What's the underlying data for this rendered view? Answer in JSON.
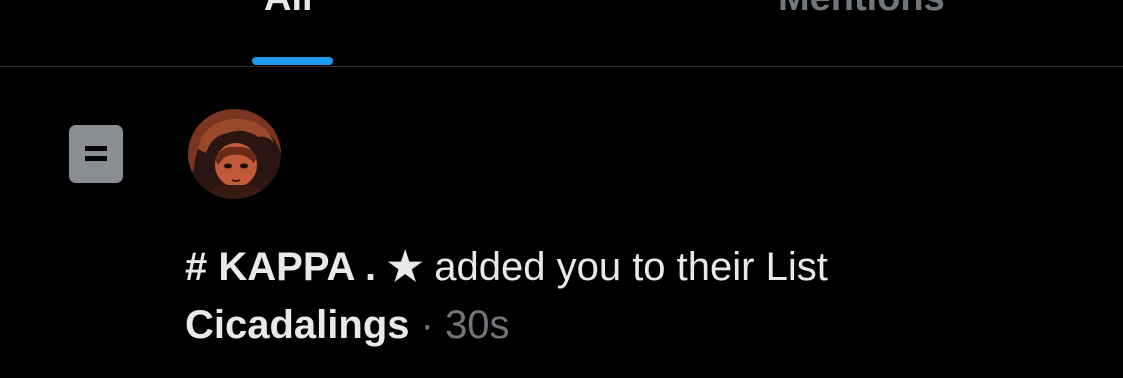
{
  "tabs": [
    {
      "label": "All",
      "selected": true
    },
    {
      "label": "Mentions",
      "selected": false
    }
  ],
  "notification": {
    "icon": "list-icon",
    "avatar": "user-avatar",
    "user_name": "# KAPPA . ★",
    "action_text": " added you to their List",
    "list_name": "Cicadalings",
    "separator": " · ",
    "timestamp": "30s"
  },
  "colors": {
    "background": "#000000",
    "text": "#e7e9ea",
    "muted": "#71767b",
    "accent": "#1d9bf0",
    "icon_bg": "#8b8f94",
    "divider": "#2f3336"
  }
}
